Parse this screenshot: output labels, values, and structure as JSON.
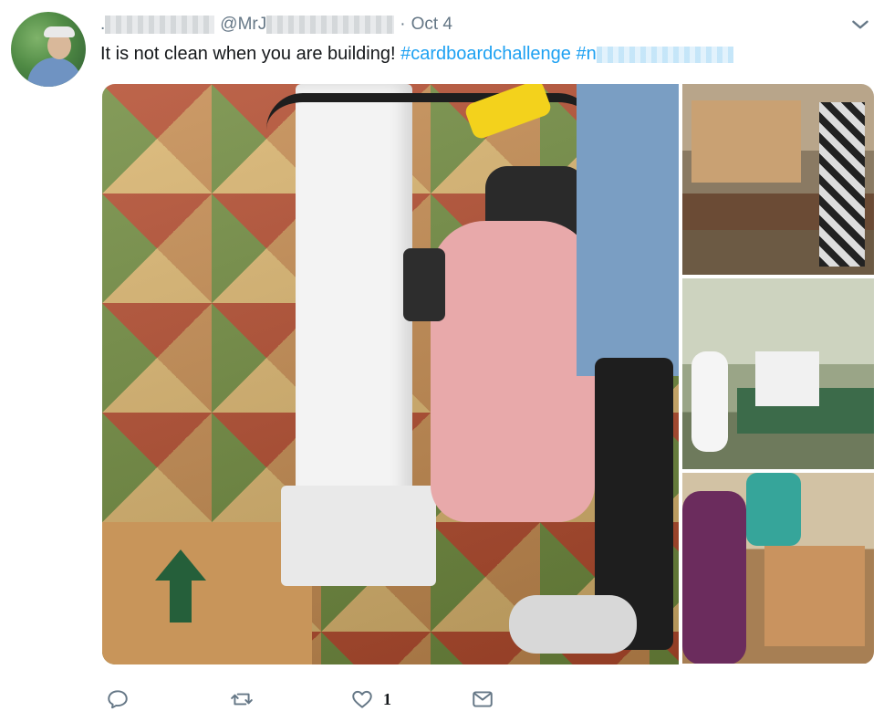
{
  "tweet": {
    "name": ".",
    "handle_prefix": "@MrJ",
    "handle_suffix": "·",
    "date": "Oct 4",
    "text": "It is not clean when you are building!",
    "hashtag1": "#cardboardchallenge",
    "hashtag2_visible": "#n"
  },
  "actions": {
    "like_count": "1"
  },
  "icons": {
    "reply": "reply-icon",
    "retweet": "retweet-icon",
    "like": "heart-icon",
    "message": "envelope-icon",
    "menu": "chevron-down-icon"
  },
  "colors": {
    "link": "#1da1f2",
    "muted": "#657786"
  }
}
